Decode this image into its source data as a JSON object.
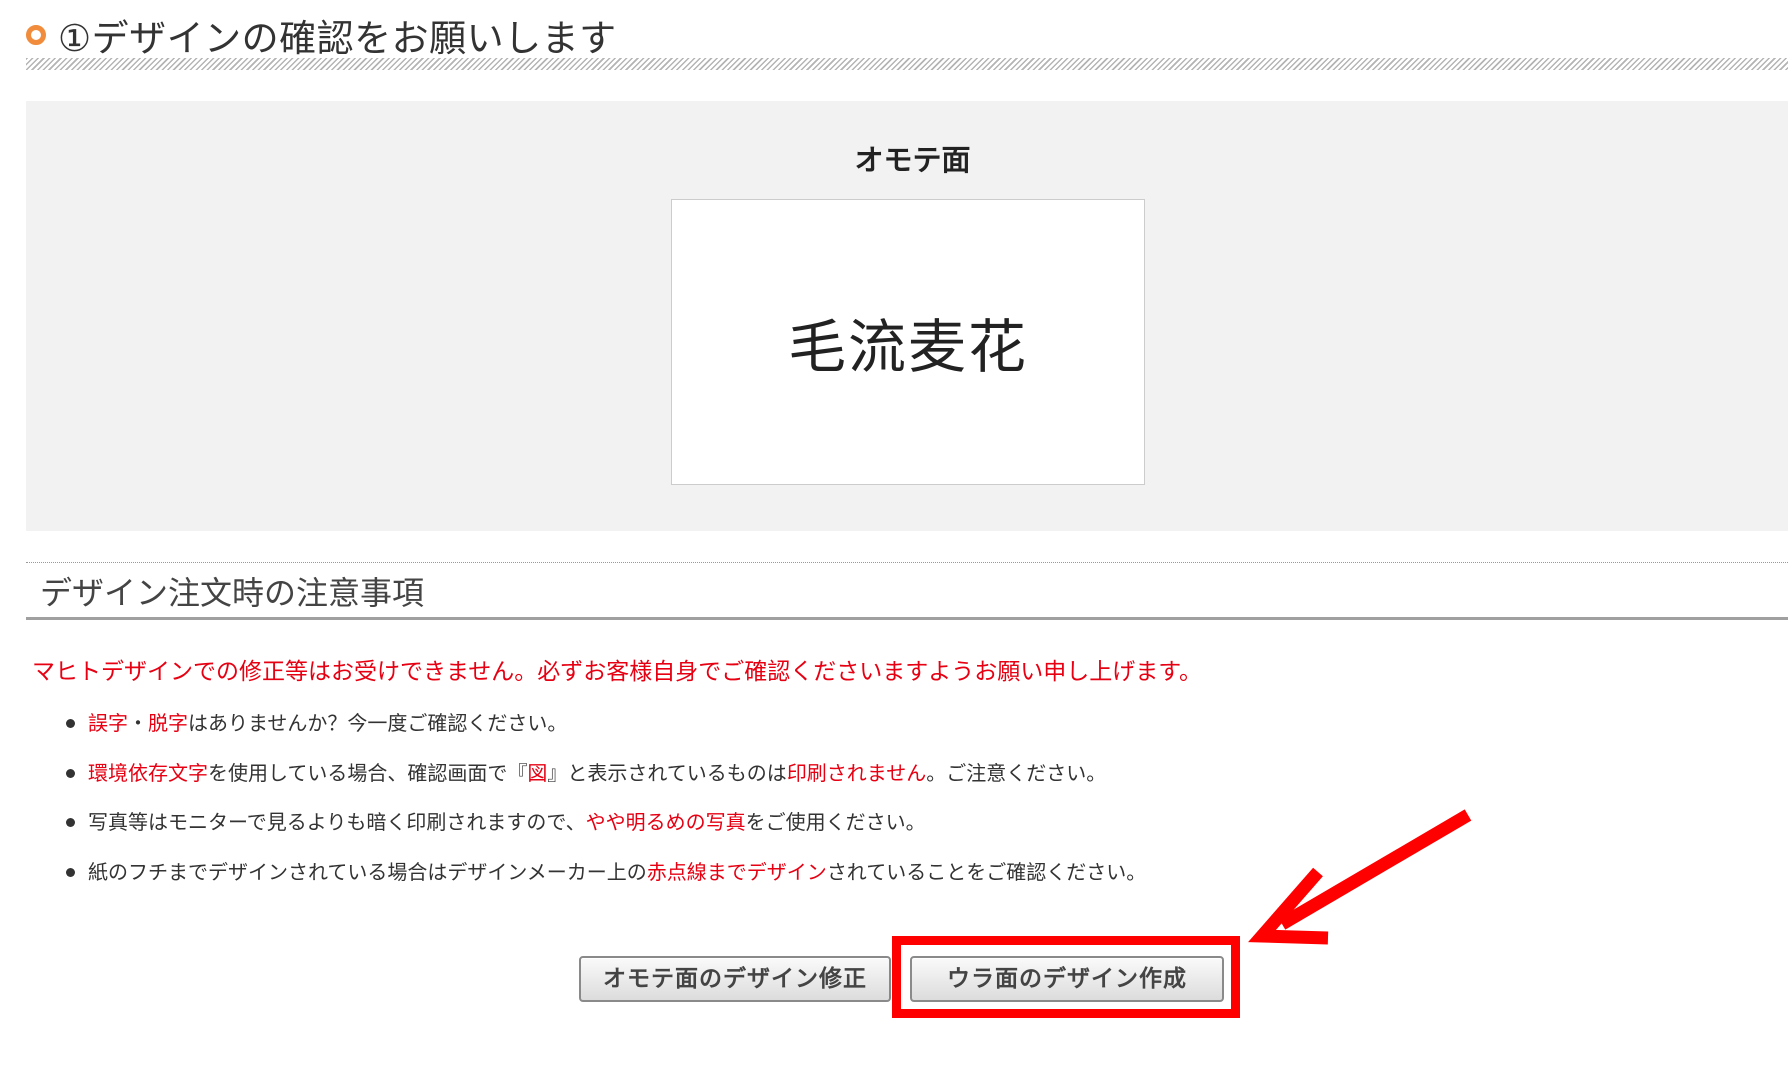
{
  "section": {
    "title": "①デザインの確認をお願いします"
  },
  "preview": {
    "face_label": "オモテ面",
    "card_name": "毛流麦花"
  },
  "notes": {
    "heading": "デザイン注文時の注意事項",
    "lead": "マヒトデザインでの修正等はお受けできません。必ずお客様自身でご確認くださいますようお願い申し上げます。",
    "items": [
      {
        "parts": [
          "誤字",
          "・",
          "脱字",
          "はありませんか？今一度ご確認ください。"
        ]
      },
      {
        "parts": [
          "環境依存文字",
          "を使用している場合、確認画面で『",
          "図",
          "』と表示されているものは",
          "印刷されません",
          "。ご注意ください。"
        ]
      },
      {
        "parts": [
          "写真等はモニターで見るよりも暗く印刷されますので、",
          "やや明るめの写真",
          "をご使用ください。"
        ]
      },
      {
        "parts": [
          "紙のフチまでデザインされている場合はデザインメーカー上の",
          "赤点線までデザイン",
          "されていることをご確認ください。"
        ]
      }
    ]
  },
  "buttons": {
    "edit_front": "オモテ面のデザイン修正",
    "create_back": "ウラ面のデザイン作成"
  },
  "colors": {
    "accent_orange": "#f08c3c",
    "warning_red": "#e60012",
    "annotation_red": "#ff0000",
    "panel_gray": "#f2f2f2"
  }
}
